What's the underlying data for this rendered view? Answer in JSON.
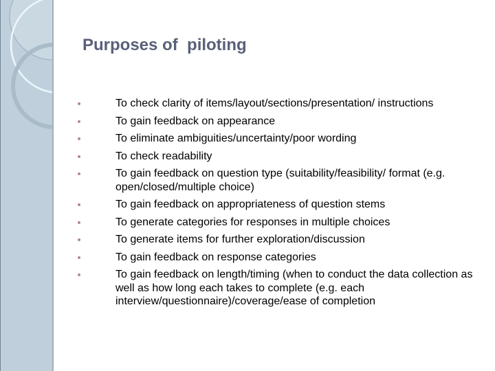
{
  "slide": {
    "title": "Purposes of  piloting",
    "colors": {
      "title": "#5a6078",
      "bullet": "#b08a86",
      "side_panel": "#bfd0dc"
    },
    "bullets": [
      {
        "text": "To check clarity of items/layout/sections/presentation/ instructions"
      },
      {
        "text": "To gain feedback on appearance"
      },
      {
        "text": "To eliminate ambiguities/uncertainty/poor wording"
      },
      {
        "text": "To check readability"
      },
      {
        "text": "To gain feedback on question type (suitability/feasibility/ format (e.g. open/closed/multiple choice)"
      },
      {
        "text": "To gain feedback on appropriateness of question stems"
      },
      {
        "text": "To generate categories for responses in multiple choices"
      },
      {
        "text": "To generate items for further exploration/discussion"
      },
      {
        "text": "To gain feedback on response categories"
      },
      {
        "text": "To gain feedback on length/timing (when to conduct the data collection as well as how long each takes to complete (e.g. each interview/questionnaire)/coverage/ease of completion"
      }
    ]
  }
}
